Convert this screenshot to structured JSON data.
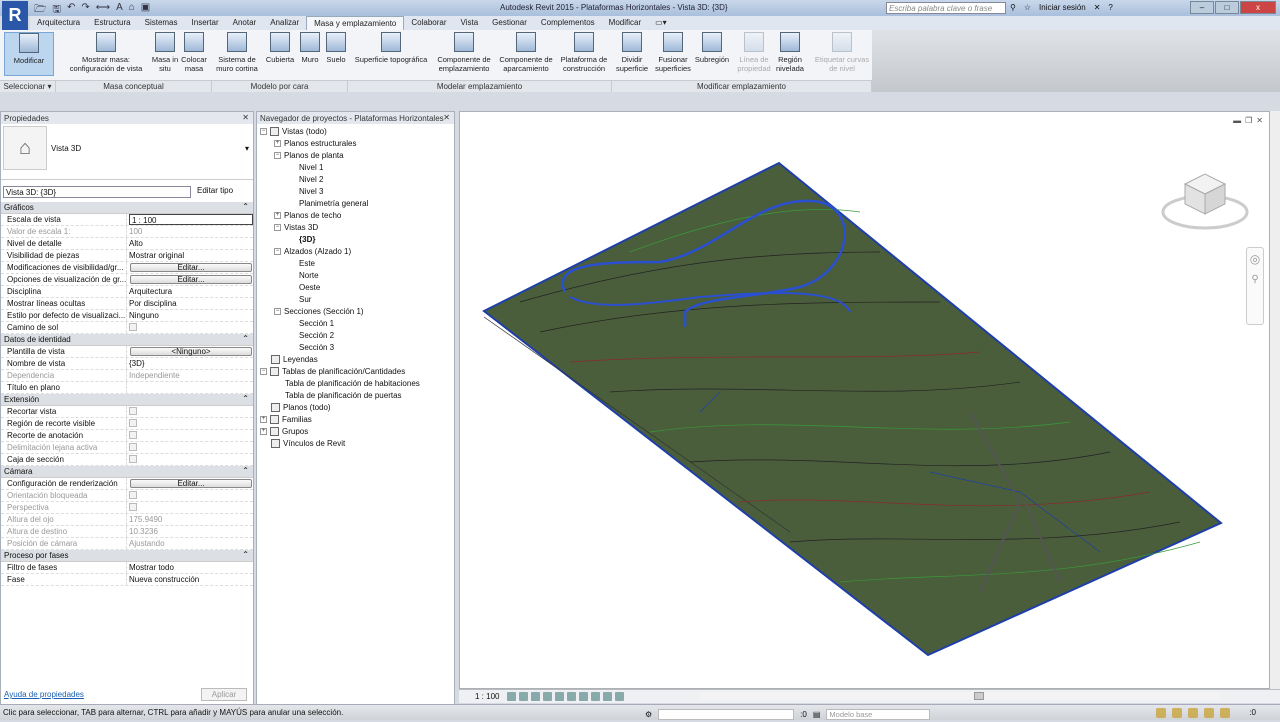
{
  "app": {
    "logo": "R",
    "title": "Autodesk Revit 2015 -    Plataformas Horizontales - Vista 3D: {3D}",
    "search_placeholder": "Escriba palabra clave o frase",
    "signin": "Iniciar sesión",
    "help": "?"
  },
  "tabs": [
    "Arquitectura",
    "Estructura",
    "Sistemas",
    "Insertar",
    "Anotar",
    "Analizar",
    "Masa y emplazamiento",
    "Colaborar",
    "Vista",
    "Gestionar",
    "Complementos",
    "Modificar",
    "▭▾"
  ],
  "active_tab": "Masa y emplazamiento",
  "ribbon": {
    "buttons": [
      {
        "label": "Modificar"
      },
      {
        "label": "Mostrar masa: configuración de vista"
      },
      {
        "label": "Masa in situ"
      },
      {
        "label": "Colocar masa"
      },
      {
        "label": "Sistema de muro cortina"
      },
      {
        "label": "Cubierta"
      },
      {
        "label": "Muro"
      },
      {
        "label": "Suelo"
      },
      {
        "label": "Superficie topográfica"
      },
      {
        "label": "Componente de emplazamiento"
      },
      {
        "label": "Componente de aparcamiento"
      },
      {
        "label": "Plataforma de construcción"
      },
      {
        "label": "Dividir superficie"
      },
      {
        "label": "Fusionar superficies"
      },
      {
        "label": "Subregión"
      },
      {
        "label": "Línea de propiedad"
      },
      {
        "label": "Región nivelada"
      },
      {
        "label": "Etiquetar curvas de nivel"
      }
    ],
    "panels": [
      "Seleccionar ▾",
      "Masa conceptual",
      "Modelo por cara",
      "Modelar emplazamiento",
      "Modificar emplazamiento"
    ]
  },
  "properties": {
    "title": "Propiedades",
    "type_name": "Vista 3D",
    "instance": "Vista 3D: {3D}",
    "edit_type": "Editar tipo",
    "groups": [
      {
        "name": "Gráficos",
        "rows": [
          {
            "label": "Escala de vista",
            "value": "1 : 100",
            "kind": "input"
          },
          {
            "label": "Valor de escala    1:",
            "value": "100",
            "kind": "text",
            "disabled": true
          },
          {
            "label": "Nivel de detalle",
            "value": "Alto",
            "kind": "text"
          },
          {
            "label": "Visibilidad de piezas",
            "value": "Mostrar original",
            "kind": "text"
          },
          {
            "label": "Modificaciones de visibilidad/gr...",
            "value": "Editar...",
            "kind": "button"
          },
          {
            "label": "Opciones de visualización de gr...",
            "value": "Editar...",
            "kind": "button"
          },
          {
            "label": "Disciplina",
            "value": "Arquitectura",
            "kind": "text"
          },
          {
            "label": "Mostrar líneas ocultas",
            "value": "Por disciplina",
            "kind": "text"
          },
          {
            "label": "Estilo por defecto de visualizaci...",
            "value": "Ninguno",
            "kind": "text"
          },
          {
            "label": "Camino de sol",
            "value": "",
            "kind": "check"
          }
        ]
      },
      {
        "name": "Datos de identidad",
        "rows": [
          {
            "label": "Plantilla de vista",
            "value": "<Ninguno>",
            "kind": "button"
          },
          {
            "label": "Nombre de vista",
            "value": "{3D}",
            "kind": "text"
          },
          {
            "label": "Dependencia",
            "value": "Independiente",
            "kind": "text",
            "disabled": true
          },
          {
            "label": "Título en plano",
            "value": "",
            "kind": "text"
          }
        ]
      },
      {
        "name": "Extensión",
        "rows": [
          {
            "label": "Recortar vista",
            "value": "",
            "kind": "check"
          },
          {
            "label": "Región de recorte visible",
            "value": "",
            "kind": "check"
          },
          {
            "label": "Recorte de anotación",
            "value": "",
            "kind": "check"
          },
          {
            "label": "Delimitación lejana activa",
            "value": "",
            "kind": "check",
            "disabled": true
          },
          {
            "label": "Caja de sección",
            "value": "",
            "kind": "check"
          }
        ]
      },
      {
        "name": "Cámara",
        "rows": [
          {
            "label": "Configuración de renderización",
            "value": "Editar...",
            "kind": "button"
          },
          {
            "label": "Orientación bloqueada",
            "value": "",
            "kind": "check",
            "disabled": true
          },
          {
            "label": "Perspectiva",
            "value": "",
            "kind": "check",
            "disabled": true
          },
          {
            "label": "Altura del ojo",
            "value": "175.9490",
            "kind": "text",
            "disabled": true
          },
          {
            "label": "Altura de destino",
            "value": "10.3236",
            "kind": "text",
            "disabled": true
          },
          {
            "label": "Posición de cámara",
            "value": "Ajustando",
            "kind": "text",
            "disabled": true
          }
        ]
      },
      {
        "name": "Proceso por fases",
        "rows": [
          {
            "label": "Filtro de fases",
            "value": "Mostrar todo",
            "kind": "text"
          },
          {
            "label": "Fase",
            "value": "Nueva construcción",
            "kind": "text"
          }
        ]
      }
    ],
    "help_link": "Ayuda de propiedades",
    "apply": "Aplicar"
  },
  "browser": {
    "title": "Navegador de proyectos - Plataformas Horizontales",
    "nodes": [
      {
        "label": "Vistas (todo)",
        "level": 0,
        "toggle": "−",
        "icon": true
      },
      {
        "label": "Planos estructurales",
        "level": 1,
        "toggle": "+"
      },
      {
        "label": "Planos de planta",
        "level": 1,
        "toggle": "−"
      },
      {
        "label": "Nivel 1",
        "level": 2
      },
      {
        "label": "Nivel 2",
        "level": 2
      },
      {
        "label": "Nivel 3",
        "level": 2
      },
      {
        "label": "Planimetría general",
        "level": 2
      },
      {
        "label": "Planos de techo",
        "level": 1,
        "toggle": "+"
      },
      {
        "label": "Vistas 3D",
        "level": 1,
        "toggle": "−"
      },
      {
        "label": "{3D}",
        "level": 2,
        "bold": true
      },
      {
        "label": "Alzados (Alzado 1)",
        "level": 1,
        "toggle": "−"
      },
      {
        "label": "Este",
        "level": 2
      },
      {
        "label": "Norte",
        "level": 2
      },
      {
        "label": "Oeste",
        "level": 2
      },
      {
        "label": "Sur",
        "level": 2
      },
      {
        "label": "Secciones (Sección 1)",
        "level": 1,
        "toggle": "−"
      },
      {
        "label": "Sección 1",
        "level": 2
      },
      {
        "label": "Sección 2",
        "level": 2
      },
      {
        "label": "Sección 3",
        "level": 2
      },
      {
        "label": "Leyendas",
        "level": 0,
        "icon": true
      },
      {
        "label": "Tablas de planificación/Cantidades",
        "level": 0,
        "toggle": "−",
        "icon": true
      },
      {
        "label": "Tabla de planificación de habitaciones",
        "level": 1
      },
      {
        "label": "Tabla de planificación de puertas",
        "level": 1
      },
      {
        "label": "Planos (todo)",
        "level": 0,
        "icon": true
      },
      {
        "label": "Familias",
        "level": 0,
        "toggle": "+",
        "icon": true
      },
      {
        "label": "Grupos",
        "level": 0,
        "toggle": "+",
        "icon": true
      },
      {
        "label": "Vínculos de Revit",
        "level": 0,
        "icon": true
      }
    ]
  },
  "view": {
    "scale": "1 : 100",
    "terrain_color": "#4a5e3c",
    "edge_color": "#1f3fa8"
  },
  "statusbar": {
    "message": "Clic para seleccionar, TAB para alternar, CTRL para añadir y MAYÚS para anular una selección.",
    "count": ":0",
    "model": "Modelo base",
    "filter_count": ":0"
  }
}
